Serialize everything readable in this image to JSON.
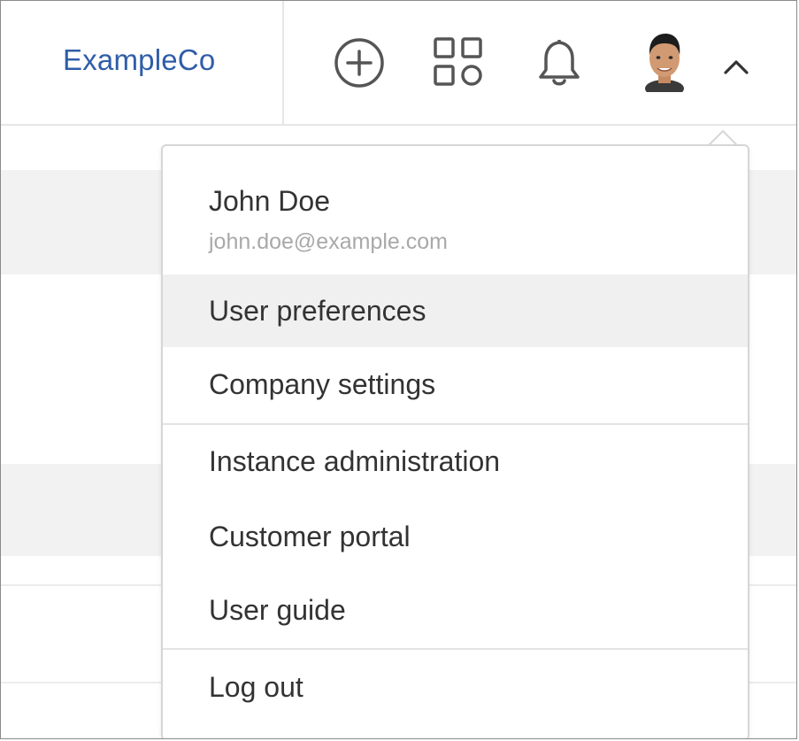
{
  "header": {
    "brand": "ExampleCo",
    "icons": {
      "create": "plus-circle-icon",
      "apps": "app-grid-icon",
      "notifications": "bell-icon",
      "avatar": "user-avatar",
      "menu_toggle": "chevron-up-icon"
    }
  },
  "user_menu": {
    "name": "John Doe",
    "email": "john.doe@example.com",
    "items": [
      {
        "label": "User preferences",
        "highlighted": true
      },
      {
        "label": "Company settings",
        "highlighted": false
      },
      {
        "label": "Instance administration",
        "highlighted": false
      },
      {
        "label": "Customer portal",
        "highlighted": false
      },
      {
        "label": "User guide",
        "highlighted": false
      },
      {
        "label": "Log out",
        "highlighted": false
      }
    ]
  },
  "colors": {
    "brand": "#2f5da8",
    "text": "#333333",
    "muted": "#a9a9a9",
    "highlight": "#f0f0f0",
    "icon": "#555555"
  }
}
